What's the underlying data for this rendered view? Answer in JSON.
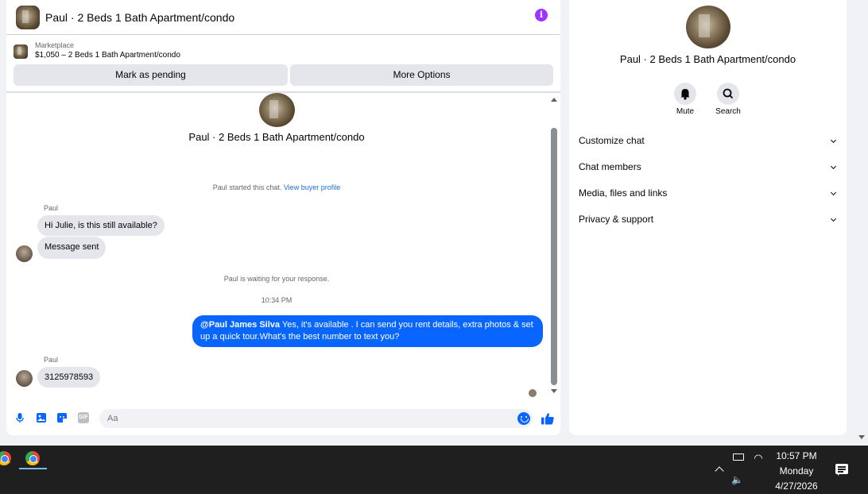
{
  "chat": {
    "title": "Paul · 2 Beds 1 Bath Apartment/condo",
    "marketplace_label": "Marketplace",
    "marketplace_detail": "$1,050 – 2 Beds 1 Bath Apartment/condo",
    "mark_pending_label": "Mark as pending",
    "more_options_label": "More Options",
    "thread_title": "Paul · 2 Beds 1 Bath Apartment/condo",
    "started_text": "Paul started this chat.",
    "view_profile_link": "View buyer profile",
    "messages": [
      {
        "sender": "Paul",
        "text": "Hi Julie, is this still available?"
      },
      {
        "text": "Message sent"
      },
      {
        "sender": "Paul",
        "text": "3125978593"
      }
    ],
    "waiting_text": "Paul is waiting for your response.",
    "timestamp": "10:34 PM",
    "outgoing": {
      "mention": "@Paul James Silva",
      "text": " Yes, it's available .  I can send you rent details, extra photos & set up a quick tour.What's the best number to text you?"
    },
    "composer_placeholder": "Aa",
    "gif_label": "GIF"
  },
  "details": {
    "title": "Paul · 2 Beds 1 Bath Apartment/condo",
    "mute_label": "Mute",
    "search_label": "Search",
    "menu": [
      {
        "label": "Customize chat"
      },
      {
        "label": "Chat members"
      },
      {
        "label": "Media, files and links"
      },
      {
        "label": "Privacy & support"
      }
    ]
  },
  "taskbar": {
    "time": "10:57 PM",
    "day": "Monday",
    "date": "4/27/2026"
  },
  "colors": {
    "accent": "#0866ff",
    "info": "#a033ff",
    "bubble_in": "#e4e6eb"
  }
}
